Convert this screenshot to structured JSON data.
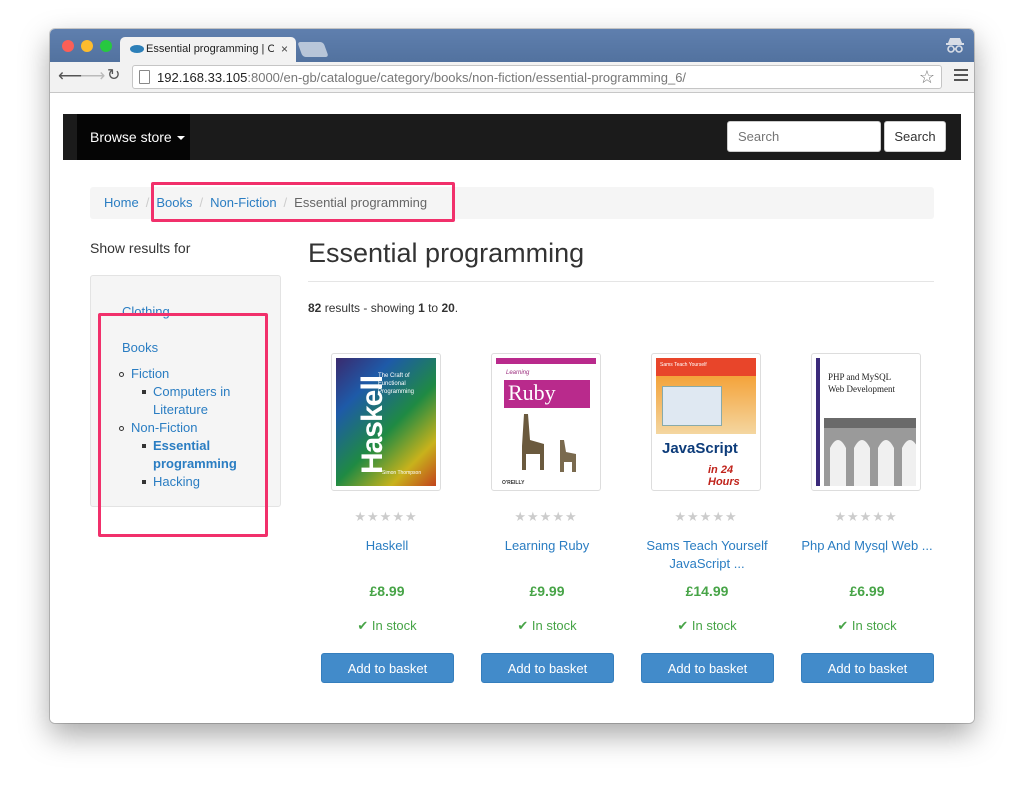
{
  "browser": {
    "tab_title": "Essential programming | Os",
    "tab_close": "×",
    "url_host": "192.168.33.105",
    "url_path": ":8000/en-gb/catalogue/category/books/non-fiction/essential-programming_6/"
  },
  "navbar": {
    "browse_label": "Browse store",
    "search_placeholder": "Search",
    "search_button": "Search"
  },
  "breadcrumb": {
    "items": [
      "Home",
      "Books",
      "Non-Fiction"
    ],
    "current": "Essential programming"
  },
  "sidebar": {
    "title": "Show results for",
    "clothing": "Clothing",
    "books": "Books",
    "fiction": "Fiction",
    "computers_line1": "Computers in",
    "computers_line2": "Literature",
    "non_fiction": "Non-Fiction",
    "essential_line1": "Essential",
    "essential_line2": "programming",
    "hacking": "Hacking"
  },
  "main": {
    "title": "Essential programming",
    "results_count": "82",
    "results_text_1": " results - showing ",
    "results_from": "1",
    "results_text_2": " to ",
    "results_to": "20",
    "results_text_3": "."
  },
  "products": [
    {
      "title_line1": "Haskell",
      "title_line2": "",
      "price": "£8.99",
      "stock": "In stock",
      "button": "Add to basket",
      "stars": "★★★★★",
      "cover_text": "Haskell",
      "cover_sub": "The Craft of Functional Programming",
      "cover_author": "Simon Thompson"
    },
    {
      "title_line1": "Learning Ruby",
      "title_line2": "",
      "price": "£9.99",
      "stock": "In stock",
      "button": "Add to basket",
      "stars": "★★★★★",
      "cover_text": "Ruby",
      "cover_sub": "Learning",
      "cover_author": "O'REILLY"
    },
    {
      "title_line1": "Sams Teach Yourself",
      "title_line2": "JavaScript ...",
      "price": "£14.99",
      "stock": "In stock",
      "button": "Add to basket",
      "stars": "★★★★★",
      "cover_text": "JavaScript",
      "cover_sub": "in 24 Hours",
      "cover_author": "Sams Teach Yourself"
    },
    {
      "title_line1": "Php And Mysql Web ...",
      "title_line2": "",
      "price": "£6.99",
      "stock": "In stock",
      "button": "Add to basket",
      "stars": "★★★★★",
      "cover_text": "PHP and MySQL",
      "cover_sub": "Web Development",
      "cover_author": ""
    }
  ],
  "colors": {
    "link": "#2a7dc2",
    "price_green": "#47a447",
    "button_blue": "#428bca",
    "highlight_pink": "#f1306b",
    "navbar_dark": "#1b1b1b"
  }
}
